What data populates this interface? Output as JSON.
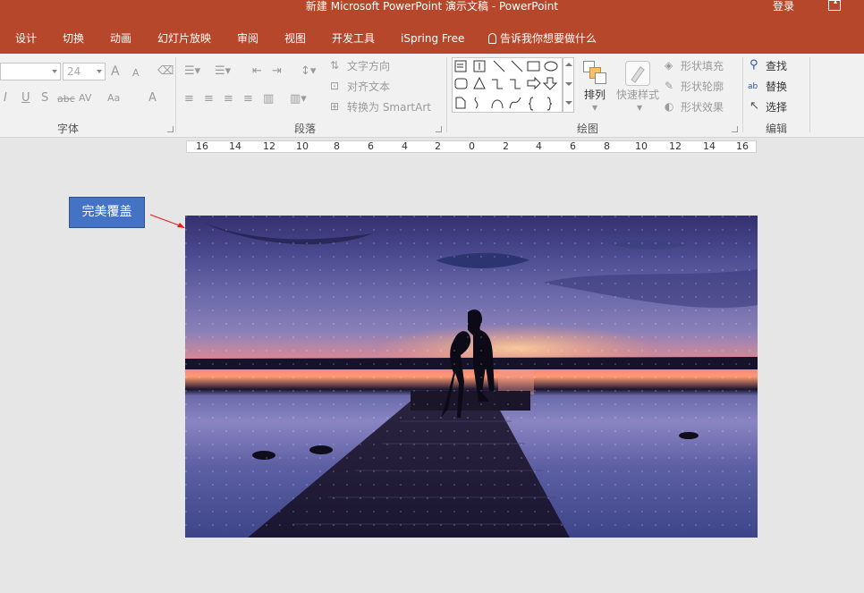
{
  "window": {
    "title": "新建 Microsoft PowerPoint 演示文稿  -  PowerPoint",
    "login": "登录"
  },
  "tabs": [
    "设计",
    "切换",
    "动画",
    "幻灯片放映",
    "审阅",
    "视图",
    "开发工具",
    "iSpring Free"
  ],
  "tell_me": "告诉我你想要做什么",
  "font_group": {
    "label": "字体",
    "font_size": "24",
    "grow_icon": "A",
    "shrink_icon": "A",
    "italic": "I",
    "underline": "U",
    "shadow": "S",
    "strike": "abc",
    "spacing": "AV",
    "case": "Aa",
    "color": "A"
  },
  "paragraph_group": {
    "label": "段落",
    "text_direction": "文字方向",
    "align_text": "对齐文本",
    "smartart": "转换为 SmartArt"
  },
  "drawing_group": {
    "label": "绘图",
    "arrange": "排列",
    "quick_styles": "快速样式",
    "shape_fill": "形状填充",
    "shape_outline": "形状轮廓",
    "shape_effects": "形状效果"
  },
  "editing_group": {
    "label": "编辑",
    "find": "查找",
    "replace": "替换",
    "select": "选择"
  },
  "ruler": [
    "16",
    "14",
    "12",
    "10",
    "8",
    "6",
    "4",
    "2",
    "0",
    "2",
    "4",
    "6",
    "8",
    "10",
    "12",
    "14",
    "16"
  ],
  "annotation": {
    "label": "完美覆盖"
  },
  "colors": {
    "accent": "#b7472a",
    "label_box": "#4472c4",
    "arrow": "#e02020"
  }
}
